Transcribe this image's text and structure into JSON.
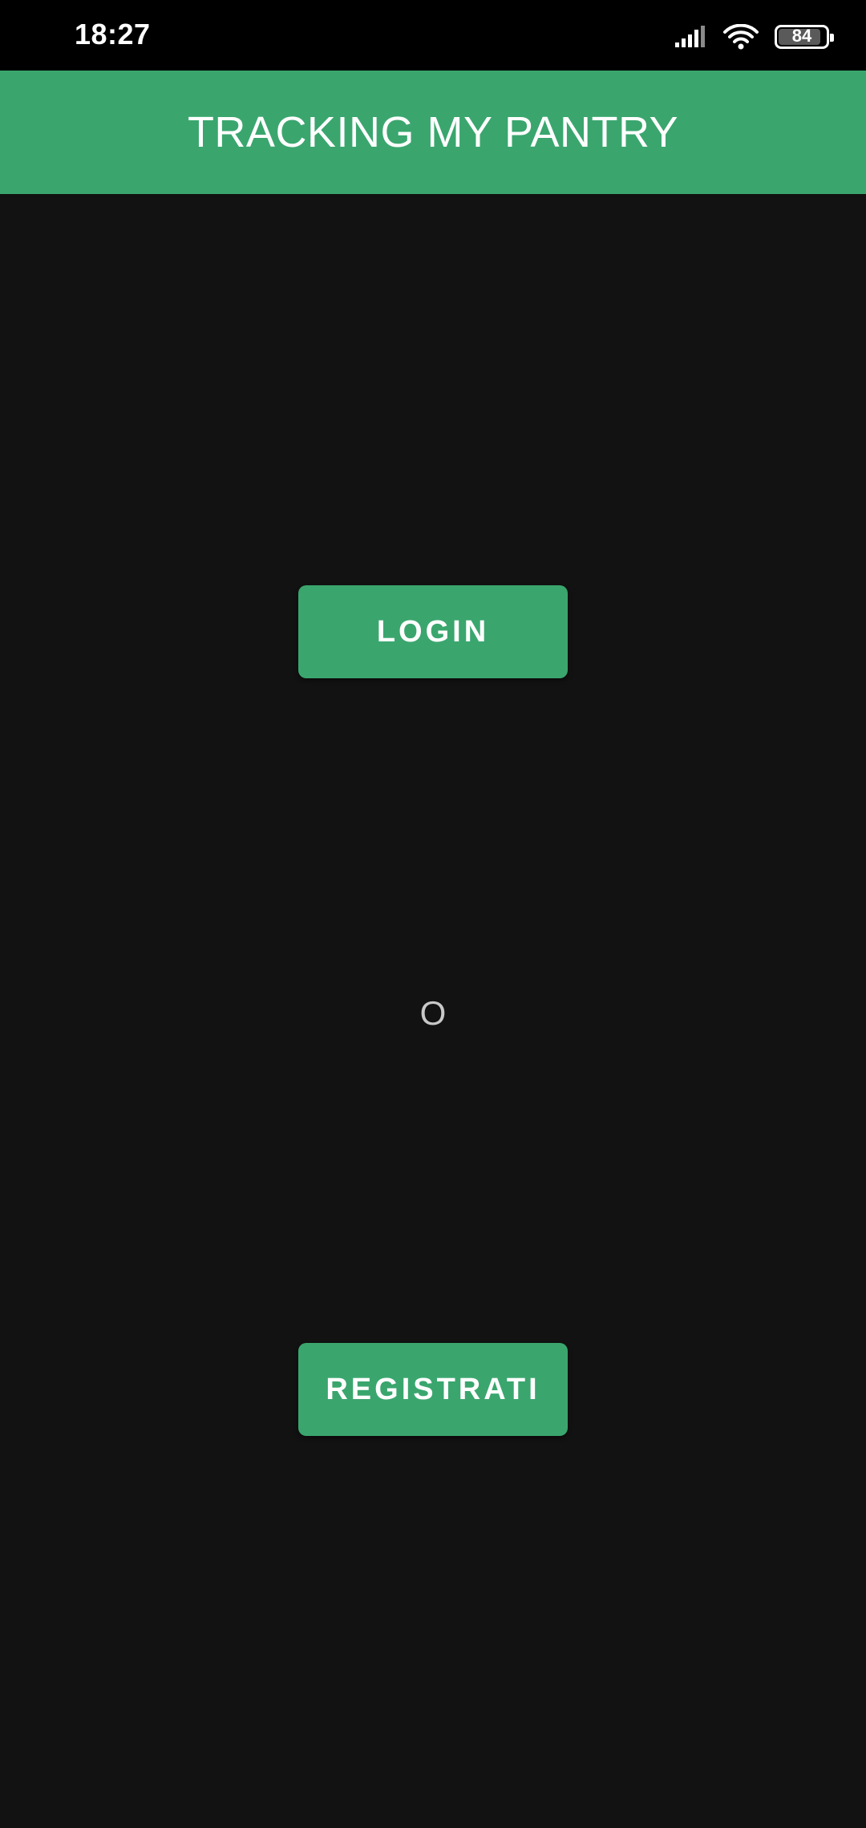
{
  "status_bar": {
    "time": "18:27",
    "battery_level": "84",
    "icons": [
      "signal-icon",
      "wifi-icon",
      "battery-icon"
    ]
  },
  "app_bar": {
    "title": "TRACKING MY PANTRY"
  },
  "main": {
    "login_label": "LOGIN",
    "separator": "O",
    "register_label": "REGISTRATI"
  },
  "colors": {
    "accent": "#3aa66e",
    "background": "#121212",
    "status_bar": "#000000"
  }
}
